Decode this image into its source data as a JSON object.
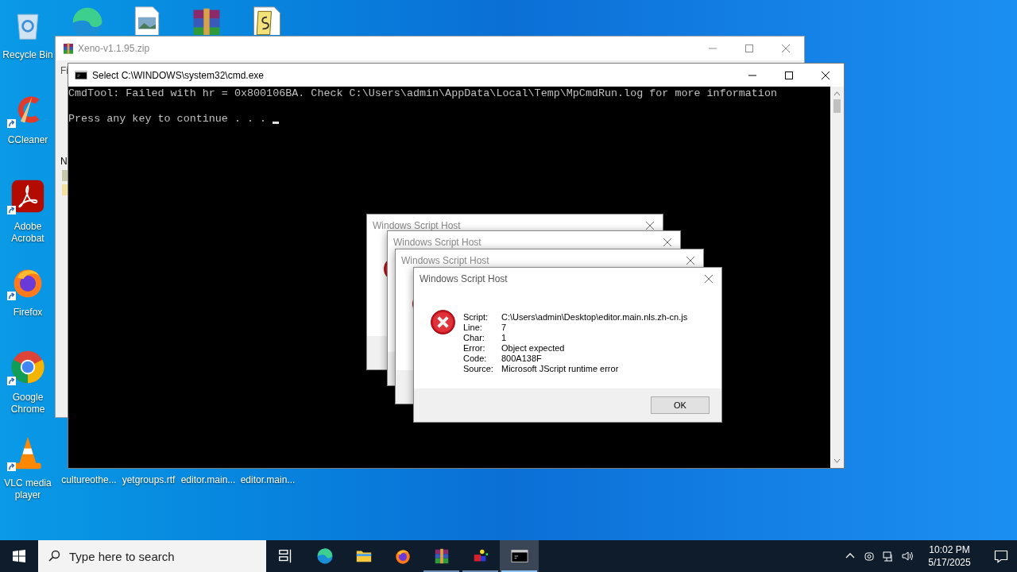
{
  "desktop_icons": [
    {
      "label": "Recycle Bin",
      "kind": "recycle",
      "shortcut": false
    },
    {
      "label": "CCleaner",
      "kind": "ccleaner",
      "shortcut": true
    },
    {
      "label": "Adobe Acrobat",
      "kind": "acrobat",
      "shortcut": true
    },
    {
      "label": "Firefox",
      "kind": "firefox",
      "shortcut": true
    },
    {
      "label": "Google Chrome",
      "kind": "chrome",
      "shortcut": true
    },
    {
      "label": "VLC media player",
      "kind": "vlc",
      "shortcut": true
    }
  ],
  "top_icons": [
    {
      "kind": "edge"
    },
    {
      "kind": "image"
    },
    {
      "kind": "archive"
    },
    {
      "kind": "script"
    }
  ],
  "file_labels": [
    "cultureothe...",
    "yetgroups.rtf",
    "editor.main...",
    "editor.main..."
  ],
  "archive_window": {
    "title": "Xeno-v1.1.95.zip",
    "menu_text": "Fi",
    "column_text": "N"
  },
  "console_window": {
    "title": "Select C:\\WINDOWS\\system32\\cmd.exe",
    "output": "CmdTool: Failed with hr = 0x800106BA. Check C:\\Users\\admin\\AppData\\Local\\Temp\\MpCmdRun.log for more information",
    "prompt": "Press any key to continue . . ."
  },
  "dialogs": [
    {
      "title": "Windows Script Host"
    },
    {
      "title": "Windows Script Host"
    },
    {
      "title": "Windows Script Host"
    },
    {
      "title": "Windows Script Host",
      "fields": [
        {
          "label": "Script:",
          "value": "C:\\Users\\admin\\Desktop\\editor.main.nls.zh-cn.js"
        },
        {
          "label": "Line:",
          "value": "7"
        },
        {
          "label": "Char:",
          "value": "1"
        },
        {
          "label": "Error:",
          "value": "Object expected"
        },
        {
          "label": "Code:",
          "value": "800A138F"
        },
        {
          "label": "Source:",
          "value": "Microsoft JScript runtime error"
        }
      ],
      "button": "OK"
    }
  ],
  "taskbar": {
    "search_placeholder": "Type here to search",
    "apps": [
      {
        "kind": "taskview",
        "running": false,
        "selected": false
      },
      {
        "kind": "edge",
        "running": false,
        "selected": false
      },
      {
        "kind": "folder",
        "running": false,
        "selected": false
      },
      {
        "kind": "firefox",
        "running": false,
        "selected": false
      },
      {
        "kind": "archive",
        "running": true,
        "selected": false
      },
      {
        "kind": "blocks",
        "running": true,
        "selected": false
      },
      {
        "kind": "console",
        "running": true,
        "selected": true
      }
    ],
    "time": "10:02 PM",
    "date": "5/17/2025"
  }
}
